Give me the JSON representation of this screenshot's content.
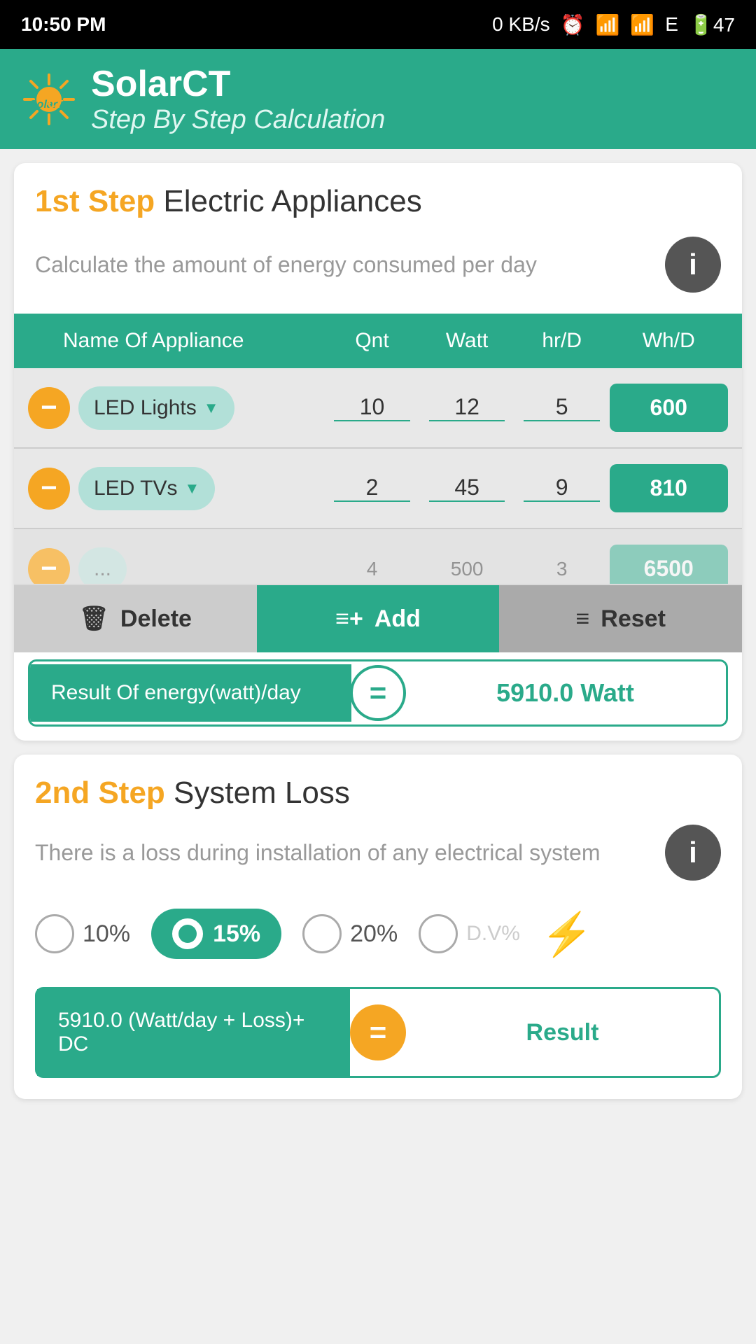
{
  "status": {
    "time": "10:50 PM",
    "kb": "0 KB/s",
    "battery": "47"
  },
  "header": {
    "app_name": "SolarCT",
    "subtitle": "Step By Step Calculation"
  },
  "step1": {
    "label": "1st Step",
    "title": "Electric Appliances",
    "description": "Calculate the amount of energy consumed per day",
    "table_headers": {
      "name": "Name Of Appliance",
      "qnt": "Qnt",
      "watt": "Watt",
      "hr_d": "hr/D",
      "wh_d": "Wh/D"
    },
    "appliances": [
      {
        "name": "LED Lights",
        "qnt": "10",
        "watt": "12",
        "hr_d": "5",
        "wh_d": "600"
      },
      {
        "name": "LED TVs",
        "qnt": "2",
        "watt": "45",
        "hr_d": "9",
        "wh_d": "810"
      },
      {
        "name": "...",
        "qnt": "4",
        "watt": "500",
        "hr_d": "3",
        "wh_d": "6500"
      }
    ],
    "buttons": {
      "delete": "Delete",
      "add": "Add",
      "reset": "Reset"
    },
    "result_label": "Result Of energy(watt)/day",
    "result_value": "5910.0  Watt"
  },
  "step2": {
    "label": "2nd Step",
    "title": "System Loss",
    "description": "There is a loss during installation of any electrical system",
    "loss_options": [
      "10%",
      "15%",
      "20%",
      "D.V%"
    ],
    "selected_loss": "15%",
    "bottom_result_label": "5910.0 (Watt/day + Loss)+ DC",
    "bottom_result_value": "Result"
  }
}
